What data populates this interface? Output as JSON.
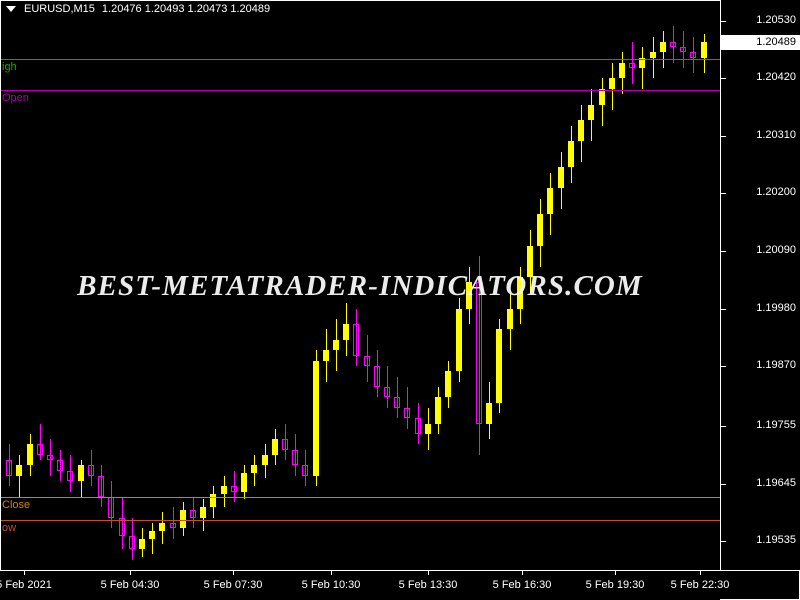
{
  "header": {
    "dropdown_icon": "triangle-down-icon",
    "symbol": "EURUSD,M15",
    "ohlc": "1.20476  1.20493  1.20473  1.20489",
    "open": "1.20476",
    "high": "1.20493",
    "low": "1.20473",
    "close": "1.20489"
  },
  "current_price": "1.20489",
  "watermark": "BEST-METATRADER-INDICATORS.COM",
  "price_ticks": [
    "1.20530",
    "1.20420",
    "1.20310",
    "1.20200",
    "1.20090",
    "1.19980",
    "1.19870",
    "1.19755",
    "1.19645",
    "1.19535"
  ],
  "time_ticks": [
    "5 Feb 2021",
    "5 Feb 04:30",
    "5 Feb 07:30",
    "5 Feb 10:30",
    "5 Feb 13:30",
    "5 Feb 16:30",
    "5 Feb 19:30",
    "5 Feb 22:30"
  ],
  "levels": [
    {
      "name": "high",
      "label": "igh",
      "price": "1.20457",
      "color": "#00b000"
    },
    {
      "name": "open",
      "label": "Open",
      "price": "1.20397",
      "color": "#b000b0"
    },
    {
      "name": "close",
      "label": "Close",
      "price": "1.19620",
      "color": "#d48000"
    },
    {
      "name": "low",
      "label": "ow",
      "price": "1.19576",
      "color": "#c05030"
    }
  ],
  "chart_data": {
    "type": "candlestick",
    "title": "EURUSD,M15",
    "xlabel": "",
    "ylabel": "",
    "ylim": [
      1.1948,
      1.2057
    ],
    "grid": false,
    "legend": "none",
    "up_color": "#ffff00",
    "down_color": "#ff00ff",
    "background": "#000000",
    "x": [
      "5 Feb 2021",
      "5 Feb 04:30",
      "5 Feb 07:30",
      "5 Feb 10:30",
      "5 Feb 13:30",
      "5 Feb 16:30",
      "5 Feb 19:30",
      "5 Feb 22:30"
    ],
    "candles": [
      {
        "o": 1.1969,
        "h": 1.1972,
        "l": 1.1964,
        "c": 1.1966
      },
      {
        "o": 1.1966,
        "h": 1.197,
        "l": 1.1962,
        "c": 1.1968
      },
      {
        "o": 1.1968,
        "h": 1.1974,
        "l": 1.1966,
        "c": 1.1972
      },
      {
        "o": 1.1972,
        "h": 1.1976,
        "l": 1.1969,
        "c": 1.197
      },
      {
        "o": 1.197,
        "h": 1.1973,
        "l": 1.1966,
        "c": 1.1969
      },
      {
        "o": 1.1969,
        "h": 1.1971,
        "l": 1.1965,
        "c": 1.1967
      },
      {
        "o": 1.1967,
        "h": 1.197,
        "l": 1.1963,
        "c": 1.1965
      },
      {
        "o": 1.1965,
        "h": 1.1969,
        "l": 1.1962,
        "c": 1.1968
      },
      {
        "o": 1.1968,
        "h": 1.1971,
        "l": 1.1964,
        "c": 1.1966
      },
      {
        "o": 1.1966,
        "h": 1.1968,
        "l": 1.196,
        "c": 1.1962
      },
      {
        "o": 1.1962,
        "h": 1.1965,
        "l": 1.1956,
        "c": 1.1958
      },
      {
        "o": 1.1958,
        "h": 1.1962,
        "l": 1.1952,
        "c": 1.19545
      },
      {
        "o": 1.19545,
        "h": 1.1958,
        "l": 1.195,
        "c": 1.1952
      },
      {
        "o": 1.1952,
        "h": 1.1956,
        "l": 1.19505,
        "c": 1.1954
      },
      {
        "o": 1.1954,
        "h": 1.1957,
        "l": 1.1951,
        "c": 1.19555
      },
      {
        "o": 1.19555,
        "h": 1.1959,
        "l": 1.1953,
        "c": 1.1957
      },
      {
        "o": 1.1957,
        "h": 1.196,
        "l": 1.1954,
        "c": 1.1956
      },
      {
        "o": 1.1956,
        "h": 1.1961,
        "l": 1.19545,
        "c": 1.19595
      },
      {
        "o": 1.19595,
        "h": 1.1962,
        "l": 1.1956,
        "c": 1.1958
      },
      {
        "o": 1.1958,
        "h": 1.19615,
        "l": 1.19555,
        "c": 1.196
      },
      {
        "o": 1.196,
        "h": 1.1964,
        "l": 1.1958,
        "c": 1.19625
      },
      {
        "o": 1.19625,
        "h": 1.1966,
        "l": 1.196,
        "c": 1.1964
      },
      {
        "o": 1.1964,
        "h": 1.1967,
        "l": 1.1961,
        "c": 1.1963
      },
      {
        "o": 1.1963,
        "h": 1.1968,
        "l": 1.19615,
        "c": 1.19665
      },
      {
        "o": 1.19665,
        "h": 1.197,
        "l": 1.1964,
        "c": 1.1968
      },
      {
        "o": 1.1968,
        "h": 1.1972,
        "l": 1.19655,
        "c": 1.197
      },
      {
        "o": 1.197,
        "h": 1.1975,
        "l": 1.1968,
        "c": 1.1973
      },
      {
        "o": 1.1973,
        "h": 1.1976,
        "l": 1.1969,
        "c": 1.1971
      },
      {
        "o": 1.1971,
        "h": 1.1974,
        "l": 1.1966,
        "c": 1.1968
      },
      {
        "o": 1.1968,
        "h": 1.1971,
        "l": 1.1964,
        "c": 1.1966
      },
      {
        "o": 1.1966,
        "h": 1.199,
        "l": 1.1964,
        "c": 1.1988
      },
      {
        "o": 1.1988,
        "h": 1.1994,
        "l": 1.1984,
        "c": 1.199
      },
      {
        "o": 1.199,
        "h": 1.1996,
        "l": 1.1986,
        "c": 1.1992
      },
      {
        "o": 1.1992,
        "h": 1.1999,
        "l": 1.1989,
        "c": 1.1995
      },
      {
        "o": 1.1995,
        "h": 1.1998,
        "l": 1.1987,
        "c": 1.1989
      },
      {
        "o": 1.1989,
        "h": 1.1993,
        "l": 1.1984,
        "c": 1.1987
      },
      {
        "o": 1.1987,
        "h": 1.199,
        "l": 1.1981,
        "c": 1.1983
      },
      {
        "o": 1.1983,
        "h": 1.1987,
        "l": 1.1979,
        "c": 1.1981
      },
      {
        "o": 1.1981,
        "h": 1.1985,
        "l": 1.1977,
        "c": 1.1979
      },
      {
        "o": 1.1979,
        "h": 1.1983,
        "l": 1.1975,
        "c": 1.1977
      },
      {
        "o": 1.1977,
        "h": 1.198,
        "l": 1.1972,
        "c": 1.1974
      },
      {
        "o": 1.1974,
        "h": 1.1979,
        "l": 1.1971,
        "c": 1.1976
      },
      {
        "o": 1.1976,
        "h": 1.1983,
        "l": 1.1974,
        "c": 1.1981
      },
      {
        "o": 1.1981,
        "h": 1.1988,
        "l": 1.1979,
        "c": 1.1986
      },
      {
        "o": 1.1986,
        "h": 1.2,
        "l": 1.1984,
        "c": 1.1998
      },
      {
        "o": 1.1998,
        "h": 1.2006,
        "l": 1.1995,
        "c": 1.2003
      },
      {
        "o": 1.2003,
        "h": 1.2008,
        "l": 1.197,
        "c": 1.1976
      },
      {
        "o": 1.1976,
        "h": 1.1984,
        "l": 1.1973,
        "c": 1.198
      },
      {
        "o": 1.198,
        "h": 1.1996,
        "l": 1.1978,
        "c": 1.1994
      },
      {
        "o": 1.1994,
        "h": 1.2001,
        "l": 1.199,
        "c": 1.1998
      },
      {
        "o": 1.1998,
        "h": 1.2006,
        "l": 1.1995,
        "c": 1.2004
      },
      {
        "o": 1.2004,
        "h": 1.2013,
        "l": 1.2001,
        "c": 1.201
      },
      {
        "o": 1.201,
        "h": 1.2019,
        "l": 1.2006,
        "c": 1.2016
      },
      {
        "o": 1.2016,
        "h": 1.2024,
        "l": 1.2012,
        "c": 1.2021
      },
      {
        "o": 1.2021,
        "h": 1.2028,
        "l": 1.2017,
        "c": 1.2025
      },
      {
        "o": 1.2025,
        "h": 1.2033,
        "l": 1.2022,
        "c": 1.203
      },
      {
        "o": 1.203,
        "h": 1.2037,
        "l": 1.2026,
        "c": 1.2034
      },
      {
        "o": 1.2034,
        "h": 1.204,
        "l": 1.203,
        "c": 1.2037
      },
      {
        "o": 1.2037,
        "h": 1.2042,
        "l": 1.2033,
        "c": 1.204
      },
      {
        "o": 1.204,
        "h": 1.2045,
        "l": 1.2036,
        "c": 1.2042
      },
      {
        "o": 1.2042,
        "h": 1.2047,
        "l": 1.2039,
        "c": 1.2045
      },
      {
        "o": 1.2045,
        "h": 1.2049,
        "l": 1.2041,
        "c": 1.2044
      },
      {
        "o": 1.2044,
        "h": 1.2048,
        "l": 1.204,
        "c": 1.2046
      },
      {
        "o": 1.2046,
        "h": 1.205,
        "l": 1.2042,
        "c": 1.2047
      },
      {
        "o": 1.2047,
        "h": 1.2051,
        "l": 1.2044,
        "c": 1.2049
      },
      {
        "o": 1.2049,
        "h": 1.2052,
        "l": 1.2045,
        "c": 1.2048
      },
      {
        "o": 1.2048,
        "h": 1.2051,
        "l": 1.2044,
        "c": 1.2047
      },
      {
        "o": 1.2047,
        "h": 1.205,
        "l": 1.2043,
        "c": 1.2046
      },
      {
        "o": 1.2046,
        "h": 1.20505,
        "l": 1.2043,
        "c": 1.20489
      }
    ]
  }
}
